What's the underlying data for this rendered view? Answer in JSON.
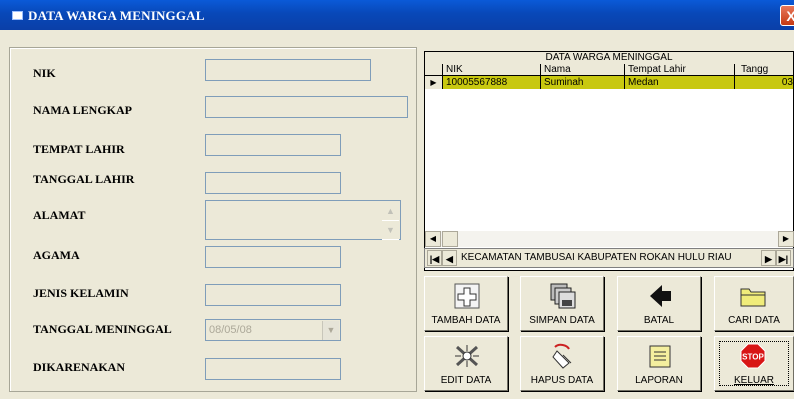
{
  "window": {
    "title": "DATA WARGA MENINGGAL",
    "close_glyph": "X"
  },
  "form": {
    "nik_label": "NIK",
    "nama_label": "NAMA LENGKAP",
    "tempat_label": "TEMPAT LAHIR",
    "tanggal_lahir_label": "TANGGAL LAHIR",
    "alamat_label": "ALAMAT",
    "agama_label": "AGAMA",
    "jenis_kelamin_label": "JENIS KELAMIN",
    "tanggal_meninggal_label": "TANGGAL MENINGGAL",
    "tanggal_meninggal_value": "08/05/08",
    "dikarenakan_label": "DIKARENAKAN"
  },
  "grid": {
    "caption": "DATA WARGA MENINGGAL",
    "columns": [
      "NIK",
      "Nama",
      "Tempat Lahir",
      "Tangg"
    ],
    "rows": [
      {
        "nik": "10005567888",
        "nama": "Suminah",
        "tempat": "Medan",
        "tanggal": "03"
      }
    ],
    "row_color": "#c8c810"
  },
  "navigator": {
    "caption": "KECAMATAN TAMBUSAI KABUPATEN ROKAN HULU RIAU"
  },
  "buttons": {
    "tambah": "TAMBAH DATA",
    "simpan": "SIMPAN DATA",
    "batal": "BATAL",
    "cari": "CARI DATA",
    "edit": "EDIT DATA",
    "hapus": "HAPUS DATA",
    "laporan": "LAPORAN",
    "keluar": "KELUAR",
    "stop_sign": "STOP"
  },
  "icons": [
    "window-icon",
    "plus-icon",
    "floppy-icon",
    "back-arrow-icon",
    "folder-icon",
    "edit-icon",
    "eraser-icon",
    "report-icon",
    "stop-icon"
  ]
}
